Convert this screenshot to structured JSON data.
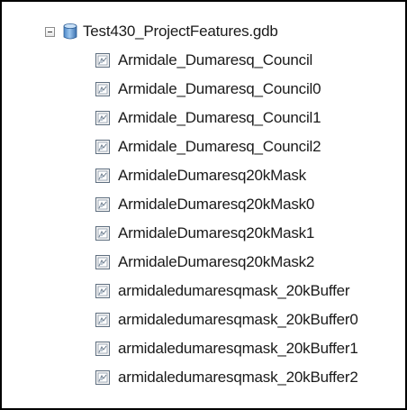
{
  "tree": {
    "root": {
      "label": "Test430_ProjectFeatures.gdb",
      "icon": "geodatabase-icon",
      "expanded": true
    },
    "items": [
      {
        "label": "Armidale_Dumaresq_Council",
        "icon": "feature-class-icon"
      },
      {
        "label": "Armidale_Dumaresq_Council0",
        "icon": "feature-class-icon"
      },
      {
        "label": "Armidale_Dumaresq_Council1",
        "icon": "feature-class-icon"
      },
      {
        "label": "Armidale_Dumaresq_Council2",
        "icon": "feature-class-icon"
      },
      {
        "label": "ArmidaleDumaresq20kMask",
        "icon": "feature-class-icon"
      },
      {
        "label": "ArmidaleDumaresq20kMask0",
        "icon": "feature-class-icon"
      },
      {
        "label": "ArmidaleDumaresq20kMask1",
        "icon": "feature-class-icon"
      },
      {
        "label": "ArmidaleDumaresq20kMask2",
        "icon": "feature-class-icon"
      },
      {
        "label": "armidaledumaresqmask_20kBuffer",
        "icon": "feature-class-icon"
      },
      {
        "label": "armidaledumaresqmask_20kBuffer0",
        "icon": "feature-class-icon"
      },
      {
        "label": "armidaledumaresqmask_20kBuffer1",
        "icon": "feature-class-icon"
      },
      {
        "label": "armidaledumaresqmask_20kBuffer2",
        "icon": "feature-class-icon"
      }
    ]
  }
}
